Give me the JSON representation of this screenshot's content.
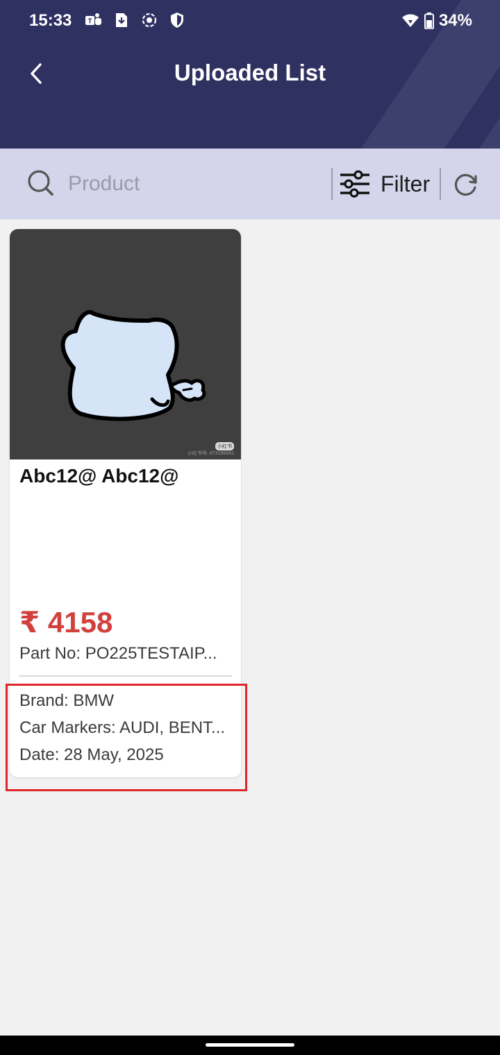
{
  "status_bar": {
    "time": "15:33",
    "battery": "34%",
    "icons": [
      "teams-icon",
      "download-icon",
      "screen-record-icon",
      "shield-icon",
      "wifi-icon",
      "battery-icon"
    ]
  },
  "header": {
    "title": "Uploaded List",
    "back_icon": "chevron-left-icon",
    "background_color": "#2f3161"
  },
  "search": {
    "placeholder": "Product",
    "value": "",
    "filter_label": "Filter",
    "background_color": "#d4d5ea"
  },
  "products": [
    {
      "title": "Abc12@ Abc12@",
      "price": "₹ 4158",
      "part_no": "Part No: PO225TESTAIP...",
      "brand": "Brand: BMW",
      "car_markers": "Car Markers: AUDI, BENT...",
      "date": "Date: 28 May, 2025",
      "image_watermark_badge": "小红书",
      "image_watermark_text": "小红书号: 873196841"
    }
  ],
  "colors": {
    "price": "#d1403c",
    "highlight": "#e0252b"
  }
}
